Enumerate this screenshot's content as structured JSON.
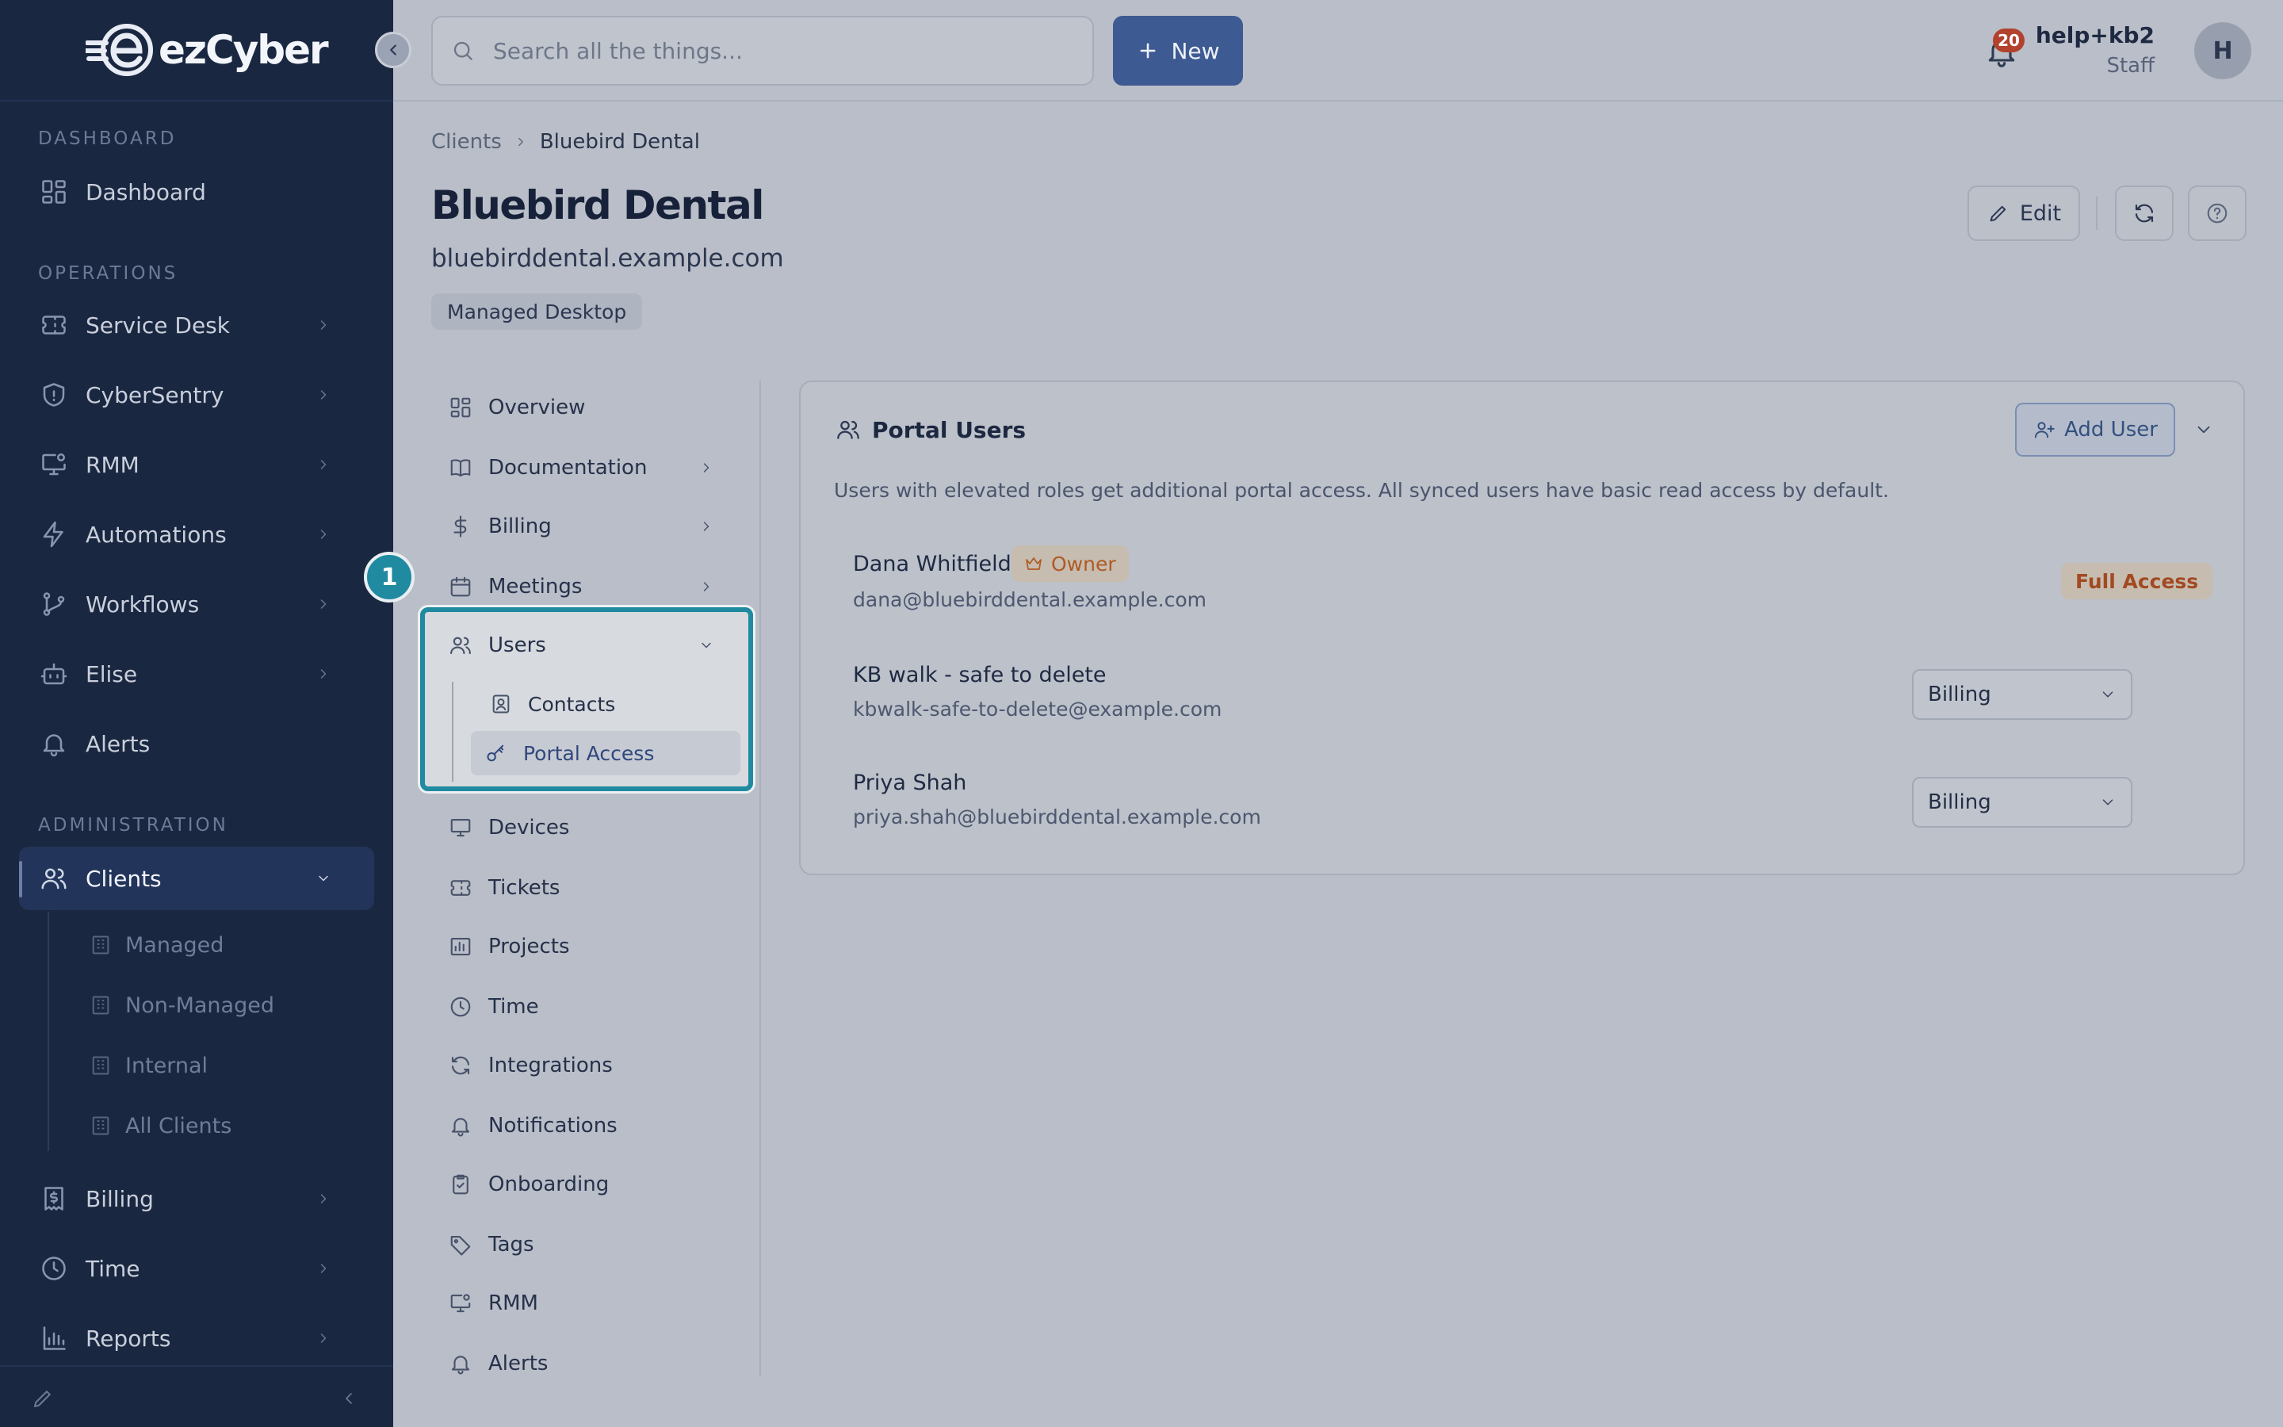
{
  "brand": {
    "name": "ezCyber"
  },
  "sidebar": {
    "sections": {
      "dashboard": "DASHBOARD",
      "operations": "OPERATIONS",
      "administration": "ADMINISTRATION"
    },
    "items": {
      "dashboard": "Dashboard",
      "service_desk": "Service Desk",
      "cybersentry": "CyberSentry",
      "rmm": "RMM",
      "automations": "Automations",
      "workflows": "Workflows",
      "elise": "Elise",
      "alerts": "Alerts",
      "clients": "Clients",
      "billing": "Billing",
      "time": "Time",
      "reports": "Reports"
    },
    "clients_sub": {
      "managed": "Managed",
      "non_managed": "Non-Managed",
      "internal": "Internal",
      "all_clients": "All Clients"
    }
  },
  "topbar": {
    "search_placeholder": "Search all the things...",
    "new_label": "New",
    "notification_count": "20",
    "user_name": "help+kb2",
    "user_role": "Staff",
    "avatar_initial": "H"
  },
  "breadcrumb": {
    "parent": "Clients",
    "current": "Bluebird Dental"
  },
  "client": {
    "name": "Bluebird Dental",
    "domain": "bluebirddental.example.com",
    "tag": "Managed Desktop"
  },
  "header_actions": {
    "edit_label": "Edit"
  },
  "subnav": {
    "overview": "Overview",
    "documentation": "Documentation",
    "billing": "Billing",
    "meetings": "Meetings",
    "users": "Users",
    "contacts": "Contacts",
    "portal_access": "Portal Access",
    "devices": "Devices",
    "tickets": "Tickets",
    "projects": "Projects",
    "time": "Time",
    "integrations": "Integrations",
    "notifications": "Notifications",
    "onboarding": "Onboarding",
    "tags": "Tags",
    "rmm": "RMM",
    "alerts": "Alerts"
  },
  "callout": {
    "step": "1"
  },
  "portal_users": {
    "title": "Portal Users",
    "add_user_label": "Add User",
    "description": "Users with elevated roles get additional portal access. All synced users have basic read access by default.",
    "users": [
      {
        "name": "Dana Whitfield",
        "email": "dana@bluebirddental.example.com",
        "badge": "Owner",
        "access": "Full Access"
      },
      {
        "name": "KB walk - safe to delete",
        "email": "kbwalk-safe-to-delete@example.com",
        "role": "Billing"
      },
      {
        "name": "Priya Shah",
        "email": "priya.shah@bluebirddental.example.com",
        "role": "Billing"
      }
    ]
  },
  "colors": {
    "sidebar_bg": "#1a2741",
    "accent": "#3e5a92",
    "highlight": "#1f8aa0",
    "badge_red": "#b2412d",
    "owner_orange": "#b05a24"
  }
}
